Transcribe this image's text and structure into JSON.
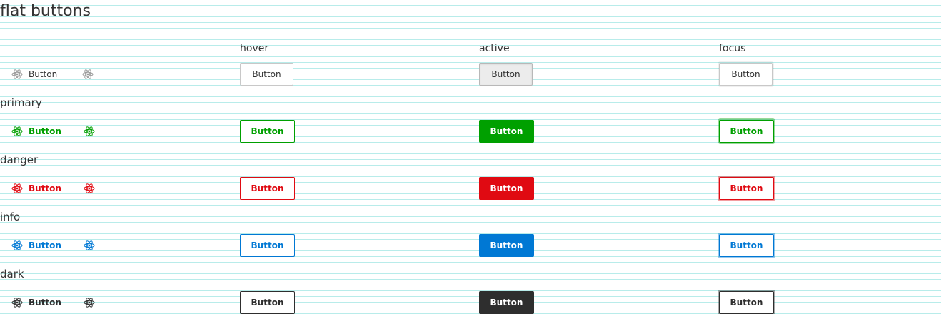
{
  "page": {
    "title": "flat buttons"
  },
  "states": {
    "hover": "hover",
    "active": "active",
    "focus": "focus"
  },
  "rows": [
    {
      "key": "default",
      "section": "",
      "color": "#555555",
      "button_label": "Button"
    },
    {
      "key": "primary",
      "section": "primary",
      "color": "#00a000",
      "button_label": "Button"
    },
    {
      "key": "danger",
      "section": "danger",
      "color": "#e00a12",
      "button_label": "Button"
    },
    {
      "key": "info",
      "section": "info",
      "color": "#0078d4",
      "button_label": "Button"
    },
    {
      "key": "dark",
      "section": "dark",
      "color": "#2e2e2e",
      "button_label": "Button"
    }
  ],
  "icons": {
    "flat_button": "atom-icon"
  }
}
